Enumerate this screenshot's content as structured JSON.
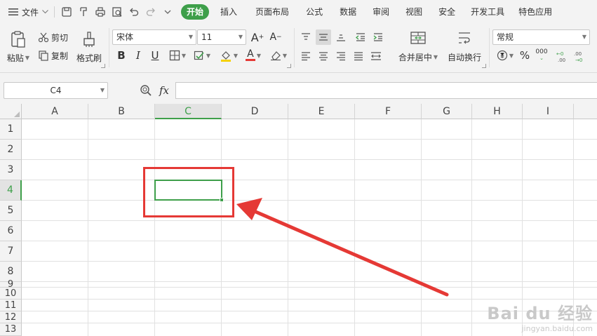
{
  "menu": {
    "file_label": "文件",
    "tabs": [
      "开始",
      "插入",
      "页面布局",
      "公式",
      "数据",
      "审阅",
      "视图",
      "安全",
      "开发工具",
      "特色应用"
    ],
    "active_tab": "开始"
  },
  "quick_access_icons": [
    "save-icon",
    "format-painter-icon",
    "print-icon",
    "print-preview-icon",
    "undo-icon",
    "redo-icon",
    "customize-icon"
  ],
  "ribbon": {
    "paste": "粘贴",
    "cut": "剪切",
    "copy": "复制",
    "format_painter": "格式刷",
    "font_name": "宋体",
    "font_size": "11",
    "bold": "B",
    "italic": "I",
    "underline": "U",
    "font_color_glyph": "A",
    "merge_center": "合并居中",
    "wrap_text": "自动换行",
    "number_format": "常规",
    "percent": "%",
    "thousands": "000"
  },
  "formula_bar": {
    "name_box": "C4",
    "fx": "fx",
    "formula": ""
  },
  "grid": {
    "columns": [
      "A",
      "B",
      "C",
      "D",
      "E",
      "F",
      "G",
      "H",
      "I"
    ],
    "rows": [
      "1",
      "2",
      "3",
      "4",
      "5",
      "6",
      "7",
      "8",
      "9",
      "10",
      "11",
      "12",
      "13"
    ],
    "selected_cell": "C4",
    "selected_column": "C",
    "selected_row": "4"
  },
  "annotation": {
    "box_color": "#e53935",
    "arrow_color": "#e53935"
  },
  "colors": {
    "accent": "#3e9f4a"
  },
  "watermark": {
    "top": "Bai du 经验",
    "bottom": "jingyan.baidu.com"
  }
}
